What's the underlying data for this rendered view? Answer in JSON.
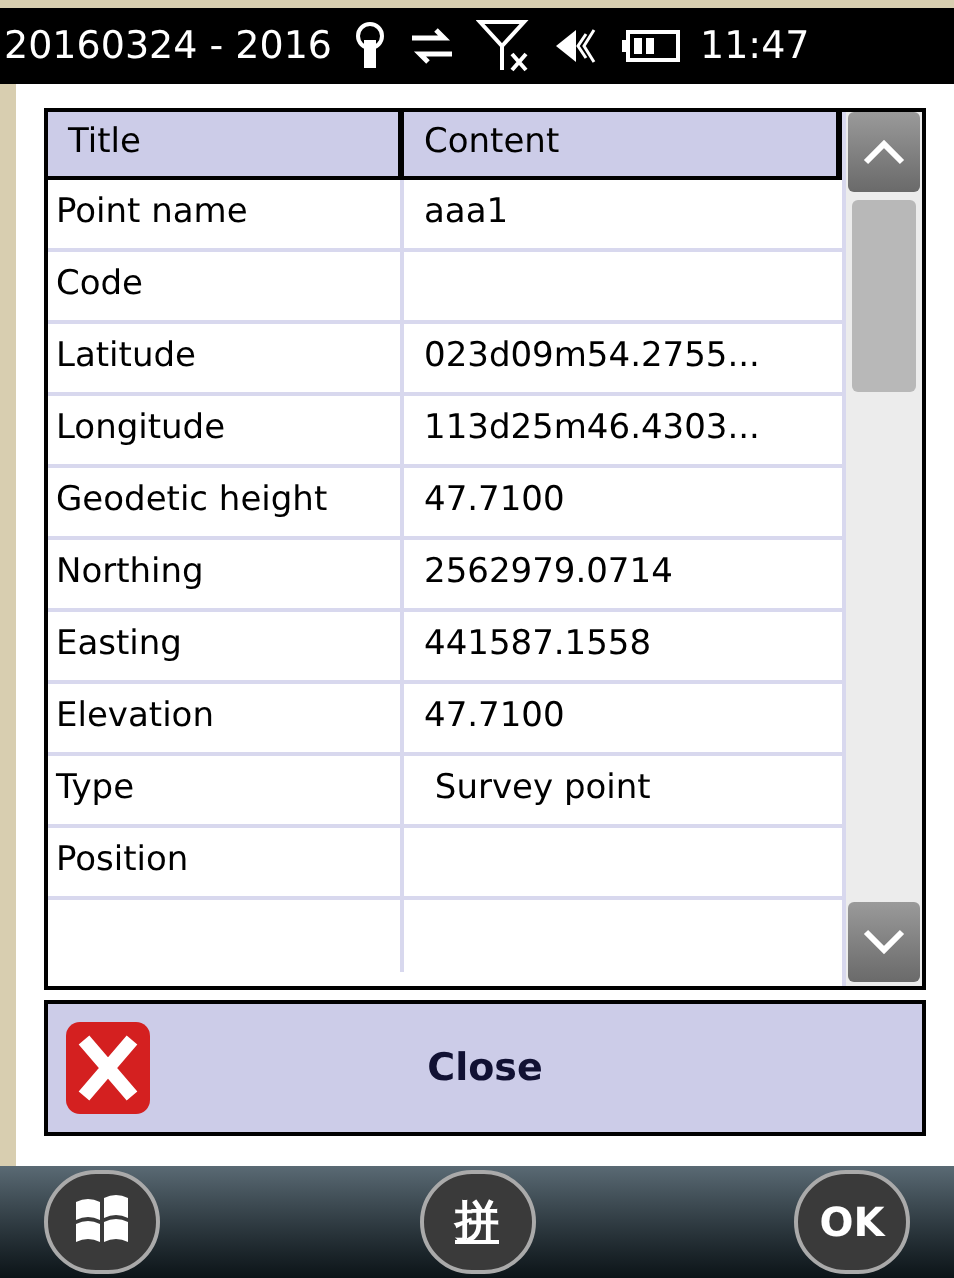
{
  "status_bar": {
    "title": "20160324 - 2016",
    "time": "11:47"
  },
  "table": {
    "columns": [
      "Title",
      "Content"
    ],
    "rows": [
      {
        "title": "Point name",
        "content": "aaa1"
      },
      {
        "title": "Code",
        "content": ""
      },
      {
        "title": "Latitude",
        "content": "023d09m54.2755..."
      },
      {
        "title": "Longitude",
        "content": "113d25m46.4303..."
      },
      {
        "title": "Geodetic height",
        "content": "47.7100"
      },
      {
        "title": "Northing",
        "content": "2562979.0714"
      },
      {
        "title": "Easting",
        "content": "441587.1558"
      },
      {
        "title": "Elevation",
        "content": "47.7100"
      },
      {
        "title": "Type",
        "content": " Survey point"
      },
      {
        "title": "Position",
        "content": ""
      }
    ]
  },
  "close_button": {
    "label": "Close"
  },
  "taskbar": {
    "input_key": "拼",
    "ok": "OK"
  }
}
